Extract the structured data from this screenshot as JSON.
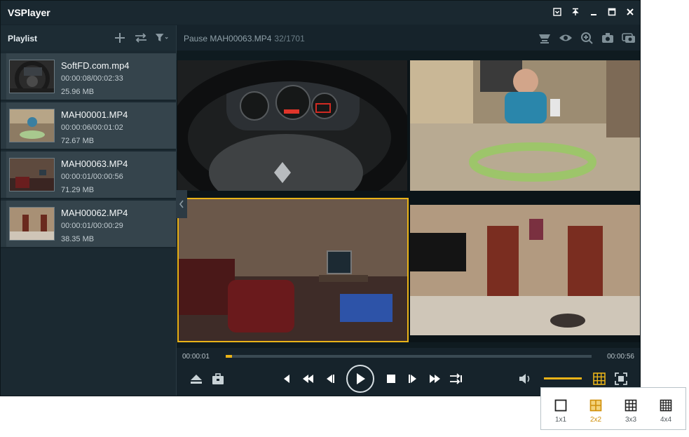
{
  "window": {
    "title": "VSPlayer"
  },
  "playlist": {
    "title": "Playlist",
    "items": [
      {
        "name": "SoftFD.com.mp4",
        "duration": "00:00:08/00:02:33",
        "size": "25.96 MB"
      },
      {
        "name": "MAH00001.MP4",
        "duration": "00:00:06/00:01:02",
        "size": "72.67 MB"
      },
      {
        "name": "MAH00063.MP4",
        "duration": "00:00:01/00:00:56",
        "size": "71.29 MB"
      },
      {
        "name": "MAH00062.MP4",
        "duration": "00:00:01/00:00:29",
        "size": "38.35 MB"
      }
    ]
  },
  "status": {
    "text": "Pause  MAH00063.MP4",
    "frame": "32/1701"
  },
  "playback": {
    "current": "00:00:01",
    "total": "00:00:56",
    "progress_fraction": 0.017,
    "volume_fraction": 1.0
  },
  "layout_options": [
    {
      "label": "1x1",
      "selected": false
    },
    {
      "label": "2x2",
      "selected": true
    },
    {
      "label": "3x3",
      "selected": false
    },
    {
      "label": "4x4",
      "selected": false
    }
  ],
  "colors": {
    "accent": "#e9b318",
    "background": "#16232b",
    "selection": "#e9b318"
  },
  "icons": {
    "title_bar": [
      "dropdown-icon",
      "pin-icon",
      "minimize-icon",
      "maximize-icon",
      "close-icon"
    ],
    "playlist_tools": [
      "add-icon",
      "swap-icon",
      "filter-icon"
    ],
    "view_tools": [
      "stream-icon",
      "eye-icon",
      "zoom-icon",
      "snapshot-icon",
      "multi-snapshot-icon"
    ],
    "controls": [
      "eject-icon",
      "toolbox-icon",
      "prev-icon",
      "rewind-icon",
      "step-back-icon",
      "play-icon",
      "stop-icon",
      "step-forward-icon",
      "fast-forward-icon",
      "repeat-icon",
      "volume-icon",
      "grid-layout-icon",
      "fullscreen-icon"
    ]
  }
}
